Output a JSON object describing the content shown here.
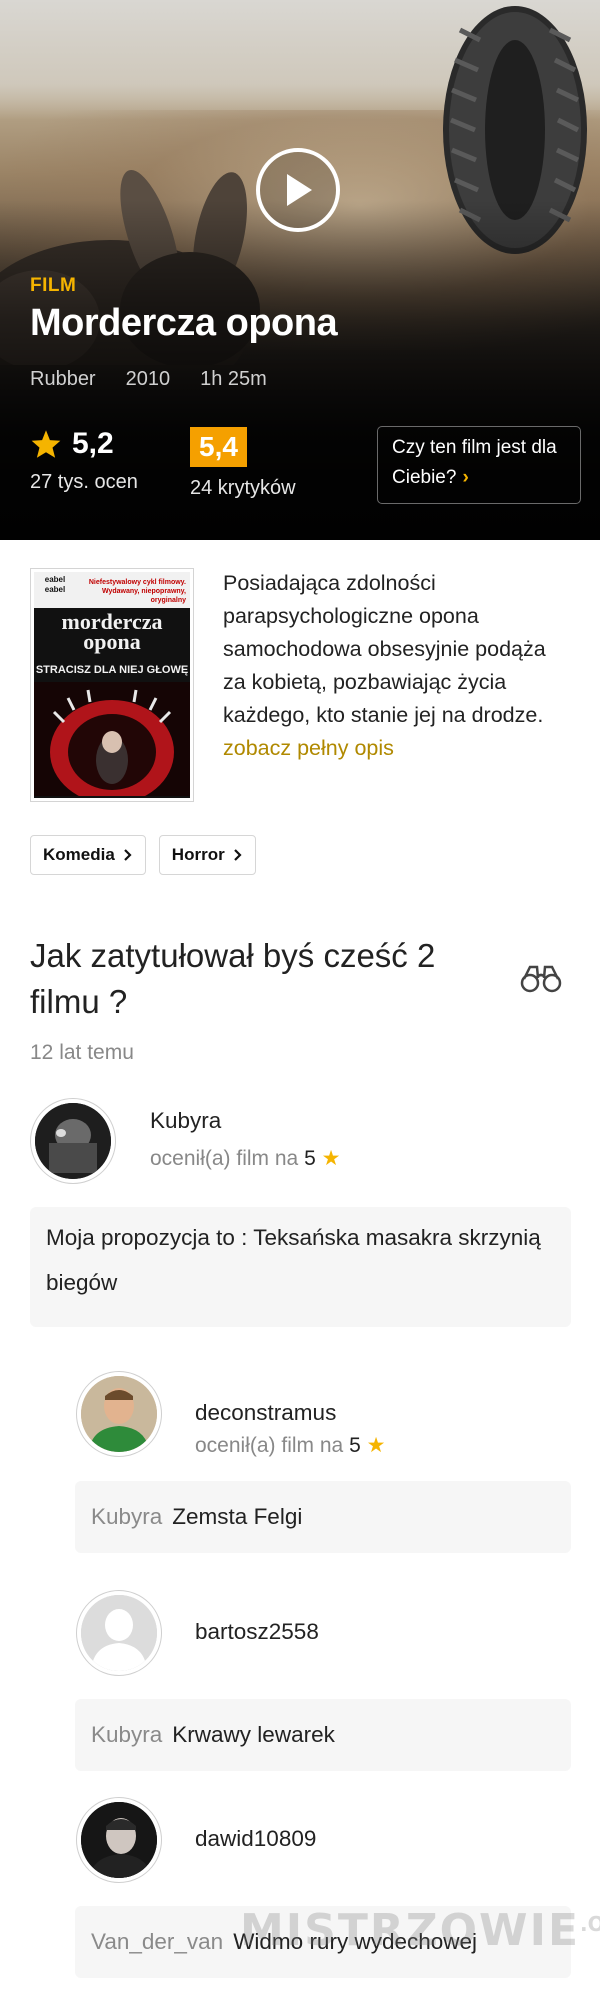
{
  "hero": {
    "kind": "FILM",
    "title": "Mordercza opona",
    "original_title": "Rubber",
    "year": "2010",
    "duration": "1h 25m",
    "user_rating": "5,2",
    "user_votes": "27 tys. ocen",
    "critics_rating": "5,4",
    "critics_count": "24 krytyków",
    "for_you_label": "Czy ten film jest dla Ciebie?",
    "accent_color": "#f5b400"
  },
  "poster": {
    "top_left": "eabel eabel",
    "top_right": "Niefestywalowy cykl filmowy. Wydawany, niepoprawny, oryginalny",
    "title": "mordercza opona",
    "tagline": "STRACISZ DLA NIEJ GŁOWĘ"
  },
  "description": {
    "text": "Posiadająca zdolności parapsychologiczne opona samochodowa obsesyjnie podąża za kobietą, pozbawiając życia każdego, kto stanie jej na drodze.",
    "more_link": "zobacz pełny opis"
  },
  "genres": [
    "Komedia",
    "Horror"
  ],
  "thread": {
    "title": "Jak zatytułował byś cześć 2 filmu ?",
    "time": "12 lat temu",
    "author": "Kubyra",
    "author_rated_prefix": "ocenił(a) film na",
    "author_rated_value": "5",
    "post": "Moja propozycja to : Teksańska masakra skrzynią biegów"
  },
  "replies": [
    {
      "user": "deconstramus",
      "rated_prefix": "ocenił(a) film na",
      "rated_value": "5",
      "to": "Kubyra",
      "text": "Zemsta Felgi"
    },
    {
      "user": "bartosz2558",
      "to": "Kubyra",
      "text": "Krwawy lewarek"
    },
    {
      "user": "dawid10809",
      "to": "Van_der_van",
      "text": "Widmo rury wydechowej"
    }
  ],
  "watermark": {
    "main": "MISTRZOWIE",
    "suffix": ".ORG"
  }
}
